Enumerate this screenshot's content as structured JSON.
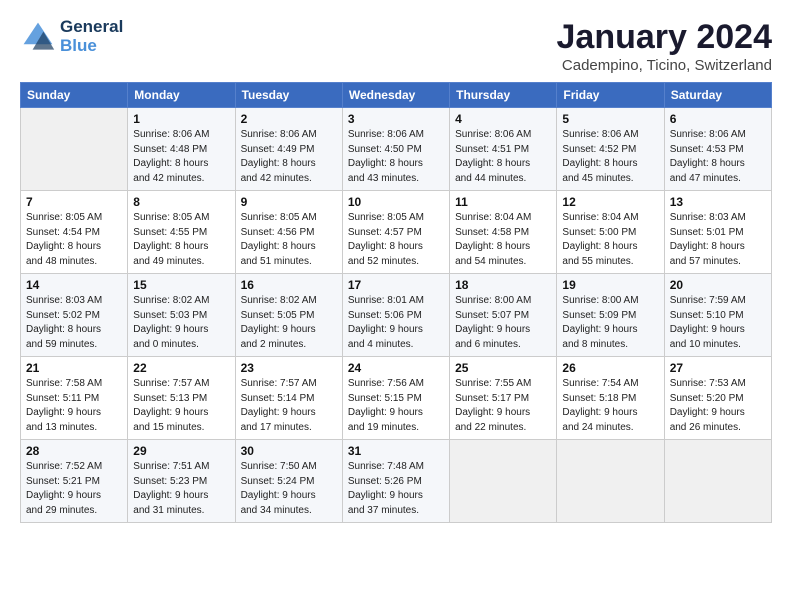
{
  "header": {
    "logo_line1": "General",
    "logo_line2": "Blue",
    "title": "January 2024",
    "subtitle": "Cadempino, Ticino, Switzerland"
  },
  "days_of_week": [
    "Sunday",
    "Monday",
    "Tuesday",
    "Wednesday",
    "Thursday",
    "Friday",
    "Saturday"
  ],
  "weeks": [
    [
      {
        "num": "",
        "info": ""
      },
      {
        "num": "1",
        "info": "Sunrise: 8:06 AM\nSunset: 4:48 PM\nDaylight: 8 hours\nand 42 minutes."
      },
      {
        "num": "2",
        "info": "Sunrise: 8:06 AM\nSunset: 4:49 PM\nDaylight: 8 hours\nand 42 minutes."
      },
      {
        "num": "3",
        "info": "Sunrise: 8:06 AM\nSunset: 4:50 PM\nDaylight: 8 hours\nand 43 minutes."
      },
      {
        "num": "4",
        "info": "Sunrise: 8:06 AM\nSunset: 4:51 PM\nDaylight: 8 hours\nand 44 minutes."
      },
      {
        "num": "5",
        "info": "Sunrise: 8:06 AM\nSunset: 4:52 PM\nDaylight: 8 hours\nand 45 minutes."
      },
      {
        "num": "6",
        "info": "Sunrise: 8:06 AM\nSunset: 4:53 PM\nDaylight: 8 hours\nand 47 minutes."
      }
    ],
    [
      {
        "num": "7",
        "info": "Sunrise: 8:05 AM\nSunset: 4:54 PM\nDaylight: 8 hours\nand 48 minutes."
      },
      {
        "num": "8",
        "info": "Sunrise: 8:05 AM\nSunset: 4:55 PM\nDaylight: 8 hours\nand 49 minutes."
      },
      {
        "num": "9",
        "info": "Sunrise: 8:05 AM\nSunset: 4:56 PM\nDaylight: 8 hours\nand 51 minutes."
      },
      {
        "num": "10",
        "info": "Sunrise: 8:05 AM\nSunset: 4:57 PM\nDaylight: 8 hours\nand 52 minutes."
      },
      {
        "num": "11",
        "info": "Sunrise: 8:04 AM\nSunset: 4:58 PM\nDaylight: 8 hours\nand 54 minutes."
      },
      {
        "num": "12",
        "info": "Sunrise: 8:04 AM\nSunset: 5:00 PM\nDaylight: 8 hours\nand 55 minutes."
      },
      {
        "num": "13",
        "info": "Sunrise: 8:03 AM\nSunset: 5:01 PM\nDaylight: 8 hours\nand 57 minutes."
      }
    ],
    [
      {
        "num": "14",
        "info": "Sunrise: 8:03 AM\nSunset: 5:02 PM\nDaylight: 8 hours\nand 59 minutes."
      },
      {
        "num": "15",
        "info": "Sunrise: 8:02 AM\nSunset: 5:03 PM\nDaylight: 9 hours\nand 0 minutes."
      },
      {
        "num": "16",
        "info": "Sunrise: 8:02 AM\nSunset: 5:05 PM\nDaylight: 9 hours\nand 2 minutes."
      },
      {
        "num": "17",
        "info": "Sunrise: 8:01 AM\nSunset: 5:06 PM\nDaylight: 9 hours\nand 4 minutes."
      },
      {
        "num": "18",
        "info": "Sunrise: 8:00 AM\nSunset: 5:07 PM\nDaylight: 9 hours\nand 6 minutes."
      },
      {
        "num": "19",
        "info": "Sunrise: 8:00 AM\nSunset: 5:09 PM\nDaylight: 9 hours\nand 8 minutes."
      },
      {
        "num": "20",
        "info": "Sunrise: 7:59 AM\nSunset: 5:10 PM\nDaylight: 9 hours\nand 10 minutes."
      }
    ],
    [
      {
        "num": "21",
        "info": "Sunrise: 7:58 AM\nSunset: 5:11 PM\nDaylight: 9 hours\nand 13 minutes."
      },
      {
        "num": "22",
        "info": "Sunrise: 7:57 AM\nSunset: 5:13 PM\nDaylight: 9 hours\nand 15 minutes."
      },
      {
        "num": "23",
        "info": "Sunrise: 7:57 AM\nSunset: 5:14 PM\nDaylight: 9 hours\nand 17 minutes."
      },
      {
        "num": "24",
        "info": "Sunrise: 7:56 AM\nSunset: 5:15 PM\nDaylight: 9 hours\nand 19 minutes."
      },
      {
        "num": "25",
        "info": "Sunrise: 7:55 AM\nSunset: 5:17 PM\nDaylight: 9 hours\nand 22 minutes."
      },
      {
        "num": "26",
        "info": "Sunrise: 7:54 AM\nSunset: 5:18 PM\nDaylight: 9 hours\nand 24 minutes."
      },
      {
        "num": "27",
        "info": "Sunrise: 7:53 AM\nSunset: 5:20 PM\nDaylight: 9 hours\nand 26 minutes."
      }
    ],
    [
      {
        "num": "28",
        "info": "Sunrise: 7:52 AM\nSunset: 5:21 PM\nDaylight: 9 hours\nand 29 minutes."
      },
      {
        "num": "29",
        "info": "Sunrise: 7:51 AM\nSunset: 5:23 PM\nDaylight: 9 hours\nand 31 minutes."
      },
      {
        "num": "30",
        "info": "Sunrise: 7:50 AM\nSunset: 5:24 PM\nDaylight: 9 hours\nand 34 minutes."
      },
      {
        "num": "31",
        "info": "Sunrise: 7:48 AM\nSunset: 5:26 PM\nDaylight: 9 hours\nand 37 minutes."
      },
      {
        "num": "",
        "info": ""
      },
      {
        "num": "",
        "info": ""
      },
      {
        "num": "",
        "info": ""
      }
    ]
  ]
}
